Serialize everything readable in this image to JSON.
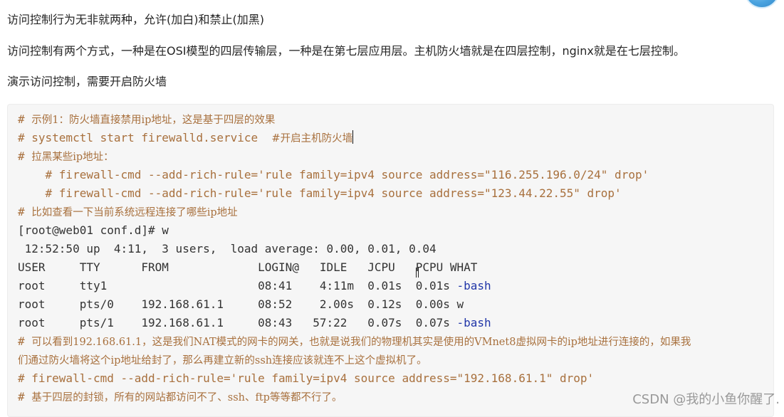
{
  "paragraphs": {
    "p1": "访问控制行为无非就两种，允许(加白)和禁止(加黑)",
    "p2": "访问控制有两个方式，一种是在OSI模型的四层传输层，一种是在第七层应用层。主机防火墙就是在四层控制，nginx就是在七层控制。",
    "p3": "演示访问控制，需要开启防火墙"
  },
  "code": {
    "l1": {
      "hash": "# ",
      "text": "示例1：防火墙直接禁用ip地址，这是基于四层的效果"
    },
    "l2": {
      "cmd": "# systemctl start firewalld.service  ",
      "note": "#开启主机防火墙"
    },
    "l3": {
      "hash": "# ",
      "text": "拉黑某些ip地址："
    },
    "l4": "    # firewall-cmd --add-rich-rule='rule family=ipv4 source address=\"116.255.196.0/24\" drop'",
    "l5": "    # firewall-cmd --add-rich-rule='rule family=ipv4 source address=\"123.44.22.55\" drop'",
    "l6": {
      "hash": "# ",
      "text": "比如查看一下当前系统远程连接了哪些ip地址"
    },
    "l7": "[root@web01 conf.d]# w",
    "l8": " 12:52:50 up  4:11,  3 users,  load average: 0.00, 0.01, 0.04",
    "l9": "USER     TTY      FROM             LOGIN@   IDLE   JCPU   PCPU WHAT",
    "l10": {
      "pre": "root     tty1                      08:41    4:11m  0.01s  0.01s ",
      "what": "-bash"
    },
    "l11": "root     pts/0    192.168.61.1     08:52    2.00s  0.12s  0.00s w",
    "l12": {
      "pre": "root     pts/1    192.168.61.1     08:43   57:22   0.07s  0.07s ",
      "what": "-bash"
    },
    "l13": {
      "hash": "# ",
      "text": "可以看到192.168.61.1，这是我们NAT模式的网卡的网关，也就是说我们的物理机其实是使用的VMnet8虚拟网卡的ip地址进行连接的，如果我"
    },
    "l14": "们通过防火墙将这个ip地址给封了，那么再建立新的ssh连接应该就连不上这个虚拟机了。",
    "l15": "# firewall-cmd --add-rich-rule='rule family=ipv4 source address=\"192.168.61.1\" drop'",
    "l16": {
      "hash": "# ",
      "text": "基于四层的封锁，所有的网站都访问不了、ssh、ftp等等都不行了。"
    }
  },
  "watermark": "CSDN @我的小鱼你醒了."
}
